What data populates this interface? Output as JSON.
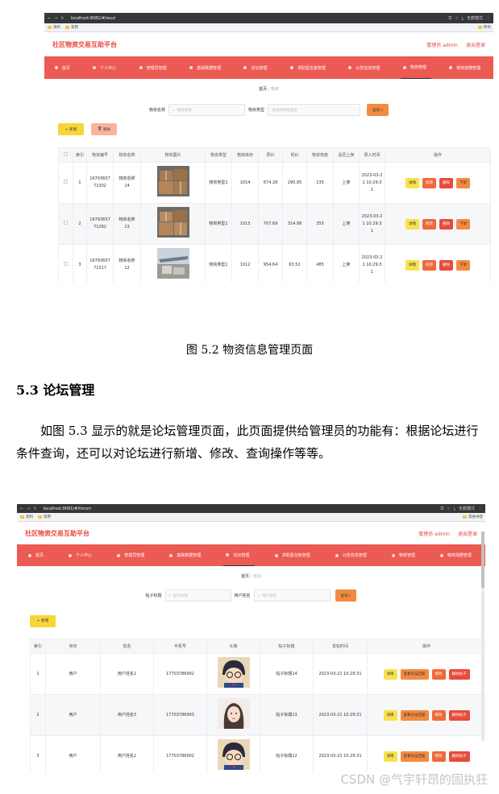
{
  "shot1": {
    "url": "localhost:8081/#/wuzi",
    "incognito": "无痕模式",
    "bookmarks": [
      "资料",
      "常用"
    ],
    "bookmarks_right": "所有",
    "site_title": "社区物资交易互助平台",
    "user": "管理员 admin",
    "logout": "退出登录",
    "menu": [
      "首页",
      "个人中心",
      "管理员管理",
      "基础数据管理",
      "论坛管理",
      "求助留言板管理",
      "公告信息管理",
      "物资管理",
      "物资捐赠管理"
    ],
    "active_menu": 7,
    "breadcrumb": {
      "home": "首页",
      "sep": "/",
      "current": "物资"
    },
    "search": {
      "label1": "物资名称",
      "placeholder1": "物资名称",
      "label2": "物资类型",
      "placeholder2": "请选择物资类型",
      "button": "查询"
    },
    "add_button": "+ 新增",
    "delete_button": "删除",
    "columns": [
      "索引",
      "物资编号",
      "物资名称",
      "物资图片",
      "物资类型",
      "物资库存",
      "原价",
      "现价",
      "物资热度",
      "是否上架",
      "录入时间",
      "操作"
    ],
    "rows": [
      {
        "index": "1",
        "code": "1679365771302",
        "name": "物资名称14",
        "type": "物资类型1",
        "stock": "1014",
        "orig": "674.28",
        "now": "290.95",
        "heat": "135",
        "onsale": "上架",
        "time": "2023-03-21 10:29:31"
      },
      {
        "index": "2",
        "code": "1679365771282",
        "name": "物资名称13",
        "type": "物资类型1",
        "stock": "1013",
        "orig": "707.69",
        "now": "314.98",
        "heat": "355",
        "onsale": "上架",
        "time": "2023-03-21 10:29:31"
      },
      {
        "index": "3",
        "code": "1679365771317",
        "name": "物资名称12",
        "type": "物资类型1",
        "stock": "1012",
        "orig": "954.64",
        "now": "63.52",
        "heat": "485",
        "onsale": "上架",
        "time": "2023-03-21 10:29:31"
      }
    ],
    "ops": {
      "detail": "详情",
      "edit": "修改",
      "del": "删除",
      "off": "下架"
    }
  },
  "caption1": "图 5.2 物资信息管理页面",
  "heading": "5.3 论坛管理",
  "paragraph": "如图 5.3 显示的就是论坛管理页面，此页面提供给管理员的功能有：根据论坛进行条件查询，还可以对论坛进行新增、修改、查询操作等等。",
  "shot2": {
    "url": "localhost:8081/#/forum",
    "incognito": "无痕模式",
    "bookmarks": [
      "资料",
      "常用"
    ],
    "bookmarks_right": "其他书签",
    "site_title": "社区物资交易互助平台",
    "user": "管理员 admin",
    "logout": "退出登录",
    "menu": [
      "首页",
      "个人中心",
      "管理员管理",
      "基础数据管理",
      "论坛管理",
      "求助留言板管理",
      "公告信息管理",
      "物资管理",
      "物资捐赠管理"
    ],
    "active_menu": 4,
    "breadcrumb": {
      "home": "首页",
      "sep": "/",
      "current": "论坛"
    },
    "search": {
      "label1": "帖子标题",
      "placeholder1": "帖子标题",
      "label2": "用户姓名",
      "placeholder2": "用户姓名",
      "button": "查询"
    },
    "add_button": "+ 新增",
    "columns": [
      "索引",
      "身份",
      "姓名",
      "手机号",
      "头像",
      "帖子标题",
      "发帖时间",
      "操作"
    ],
    "rows": [
      {
        "index": "1",
        "role": "用户",
        "name": "用户姓名2",
        "phone": "17703786902",
        "title": "帖子标题14",
        "time": "2023-03-21 10:29:31"
      },
      {
        "index": "2",
        "role": "用户",
        "name": "用户姓名3",
        "phone": "17703786903",
        "title": "帖子标题13",
        "time": "2023-03-21 10:29:31"
      },
      {
        "index": "3",
        "role": "用户",
        "name": "用户姓名2",
        "phone": "17703786902",
        "title": "帖子标题12",
        "time": "2023-03-21 10:29:31"
      }
    ],
    "ops": {
      "detail": "详情",
      "view": "查看论坛回复",
      "edit": "修改",
      "del": "删除帖子"
    }
  },
  "watermark": "CSDN @气宇轩昂的固执狂"
}
